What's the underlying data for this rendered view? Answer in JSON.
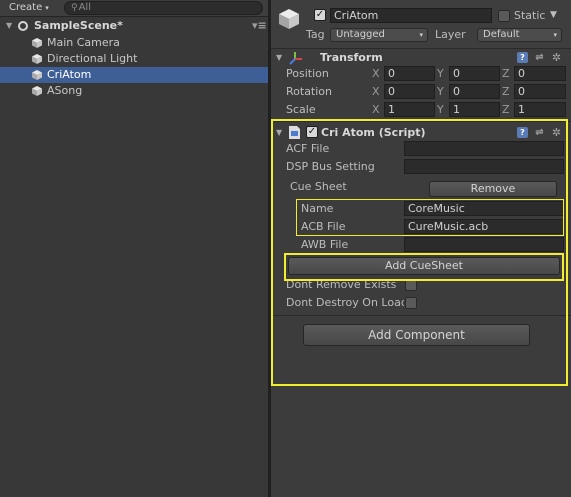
{
  "hierarchy": {
    "create_label": "Create",
    "search_placeholder": "All",
    "scene_name": "SampleScene*",
    "items": [
      {
        "label": "Main Camera",
        "selected": false
      },
      {
        "label": "Directional Light",
        "selected": false
      },
      {
        "label": "CriAtom",
        "selected": true
      },
      {
        "label": "ASong",
        "selected": false
      }
    ]
  },
  "inspector": {
    "object_name": "CriAtom",
    "active": true,
    "static_label": "Static",
    "static_checked": false,
    "tag_label": "Tag",
    "tag_value": "Untagged",
    "layer_label": "Layer",
    "layer_value": "Default",
    "transform": {
      "title": "Transform",
      "rows": [
        {
          "label": "Position",
          "x": "0",
          "y": "0",
          "z": "0"
        },
        {
          "label": "Rotation",
          "x": "0",
          "y": "0",
          "z": "0"
        },
        {
          "label": "Scale",
          "x": "1",
          "y": "1",
          "z": "1"
        }
      ],
      "axis_x": "X",
      "axis_y": "Y",
      "axis_z": "Z"
    },
    "criatom": {
      "title": "Cri Atom (Script)",
      "enabled": true,
      "acf_label": "ACF File",
      "acf_value": "",
      "dsp_label": "DSP Bus Setting",
      "dsp_value": "",
      "cue_sheet_label": "Cue Sheet",
      "remove_label": "Remove",
      "name_label": "Name",
      "name_value": "CoreMusic",
      "acb_label": "ACB File",
      "acb_value": "CureMusic.acb",
      "awb_label": "AWB File",
      "awb_value": "",
      "add_cuesheet_label": "Add CueSheet",
      "dont_remove_label": "Dont Remove Exists",
      "dont_remove_checked": false,
      "dont_destroy_label": "Dont Destroy On Load",
      "dont_destroy_checked": false
    },
    "add_component_label": "Add Component"
  },
  "colors": {
    "selection": "#3e5f96",
    "highlight": "#f2ee2f",
    "background": "#383838"
  }
}
